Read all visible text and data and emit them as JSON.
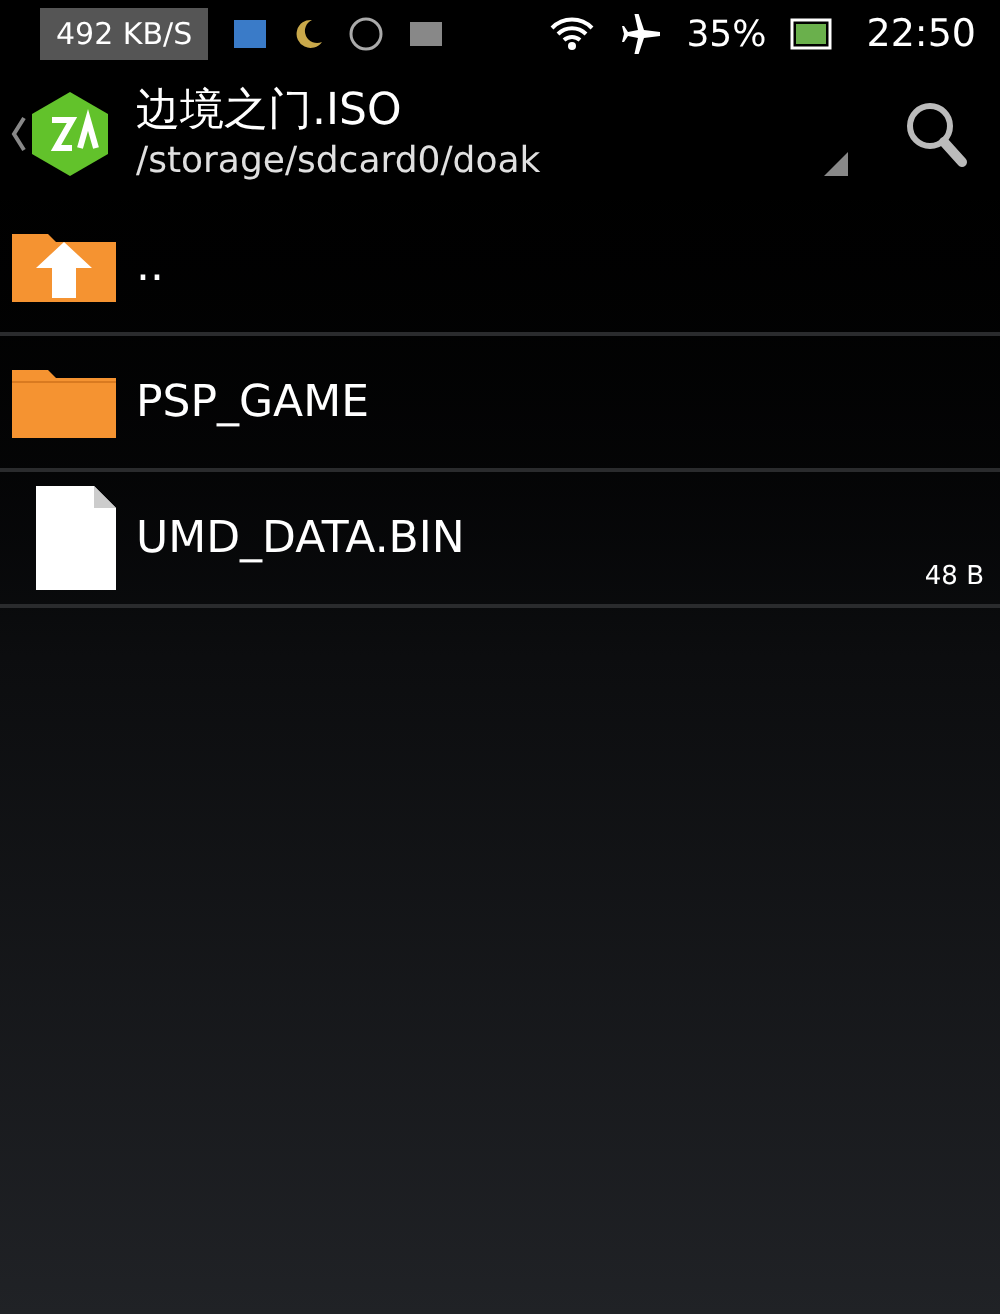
{
  "status_bar": {
    "net_speed": "492 KB/S",
    "battery": "35%",
    "time": "22:50"
  },
  "action_bar": {
    "title": "边境之门.ISO",
    "path": "/storage/sdcard0/doak"
  },
  "files": [
    {
      "kind": "up",
      "name": ".."
    },
    {
      "kind": "folder",
      "name": "PSP_GAME"
    },
    {
      "kind": "file",
      "name": "UMD_DATA.BIN",
      "size": "48 B"
    }
  ]
}
